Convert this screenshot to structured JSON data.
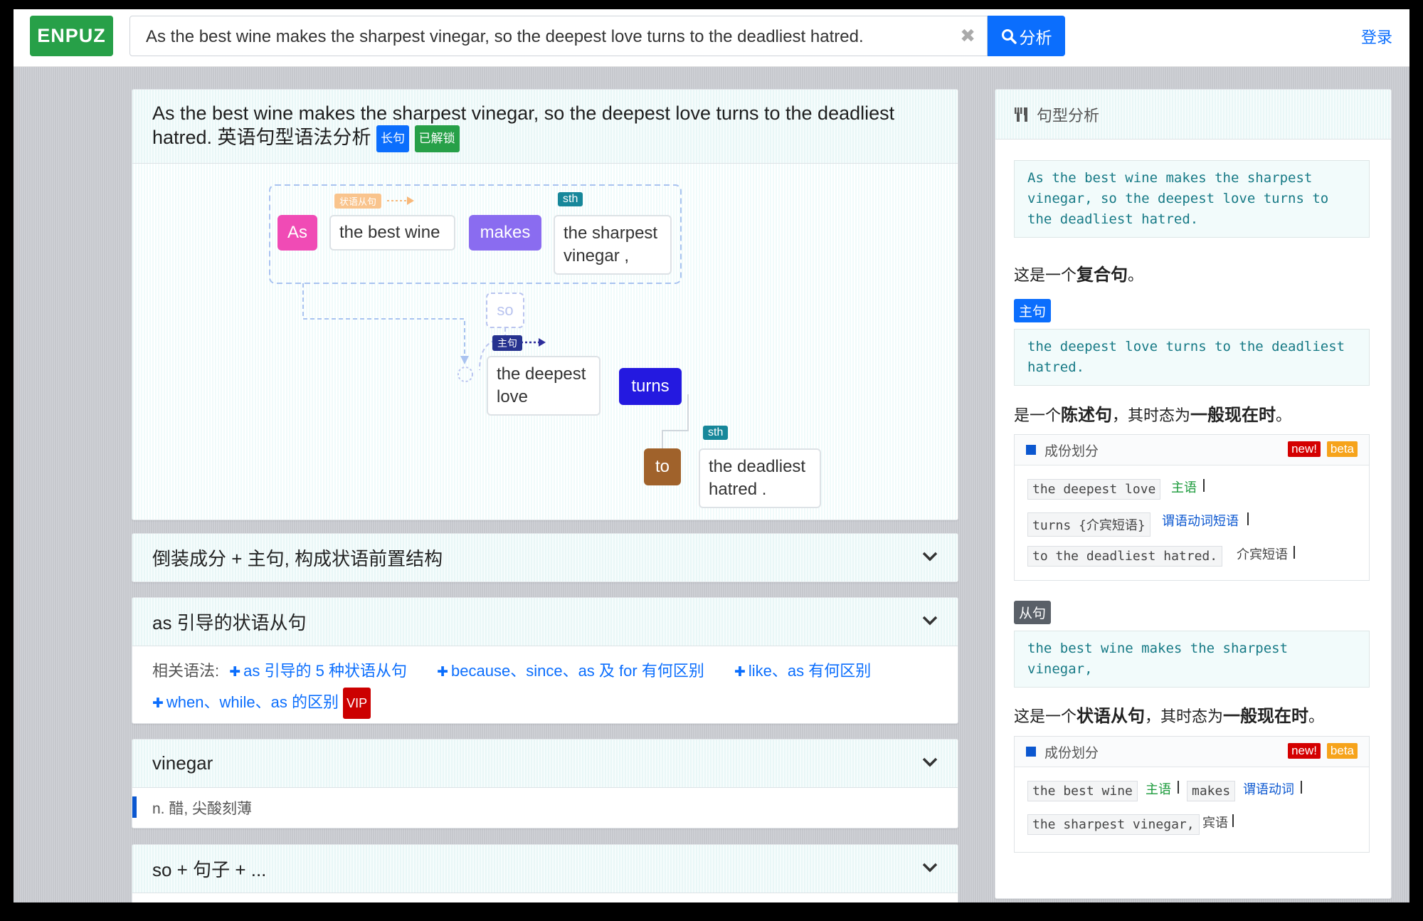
{
  "header": {
    "logo": "ENPUZ",
    "search_value": "As the best wine makes the sharpest vinegar, so the deepest love turns to the deadliest hatred.",
    "clear_glyph": "✖",
    "analyze_label": "分析",
    "login_label": "登录"
  },
  "main": {
    "title": "As the best wine makes the sharpest vinegar, so the deepest love turns to the deadliest hatred. 英语句型语法分析",
    "badge_long": "长句",
    "badge_unlocked": "已解锁",
    "diagram": {
      "tag_adv_clause": "状语从句",
      "tag_sth1": "sth",
      "tag_main": "主句",
      "tag_sth2": "sth",
      "node_as": "As",
      "node_wine": "the best wine",
      "node_makes": "makes",
      "node_vinegar": "the sharpest vinegar ,",
      "node_so": "so",
      "node_love": "the deepest love",
      "node_turns": "turns",
      "node_to": "to",
      "node_hatred": "the deadliest hatred ."
    },
    "sections": [
      {
        "title": "倒装成分 + 主句, 构成状语前置结构"
      },
      {
        "title": "as 引导的状语从句",
        "related_label": "相关语法:",
        "links": [
          "as 引导的 5 种状语从句",
          "because、since、as 及 for 有何区别",
          "like、as 有何区别",
          "when、while、as 的区别"
        ],
        "vip": "VIP"
      },
      {
        "title": "vinegar",
        "definition": "n. 醋, 尖酸刻薄"
      },
      {
        "title": "so + 句子 + ..."
      }
    ]
  },
  "sidebar": {
    "title": "句型分析",
    "sentence": "As the best wine makes the sharpest vinegar, so the deepest love turns to the deadliest hatred.",
    "summary_pre": "这是一个",
    "summary_bold": "复合句",
    "summary_post": "。",
    "main_label": "主句",
    "main_sentence": "the deepest love turns to the deadliest hatred.",
    "main_desc_pre": "是一个",
    "main_desc_bold1": "陈述句",
    "main_desc_mid": "，其时态为",
    "main_desc_bold2": "一般现在时",
    "main_desc_post": "。",
    "comp_title": "成份划分",
    "new_badge": "new!",
    "beta_badge": "beta",
    "main_parts": [
      {
        "text": "the deepest love",
        "role": "主语"
      },
      {
        "text": "turns {介宾短语}",
        "role": "谓语动词短语"
      },
      {
        "text": "to the deadliest hatred.",
        "role": "介宾短语"
      }
    ],
    "sub_label": "从句",
    "sub_sentence": "the best wine makes the sharpest vinegar,",
    "sub_desc_pre": "这是一个",
    "sub_desc_bold1": "状语从句",
    "sub_desc_mid": "，其时态为",
    "sub_desc_bold2": "一般现在时",
    "sub_desc_post": "。",
    "sub_parts": [
      {
        "text": "the best wine",
        "role": "主语"
      },
      {
        "text": "makes",
        "role": "谓语动词"
      },
      {
        "text": "the sharpest vinegar,",
        "role": "宾语"
      }
    ]
  },
  "colors": {
    "blue": "#0b6efd",
    "green": "#27a048",
    "pink": "#f04bb5",
    "purple": "#8a6cf0",
    "turns_blue": "#2419e0",
    "to_brown": "#a0622b"
  }
}
